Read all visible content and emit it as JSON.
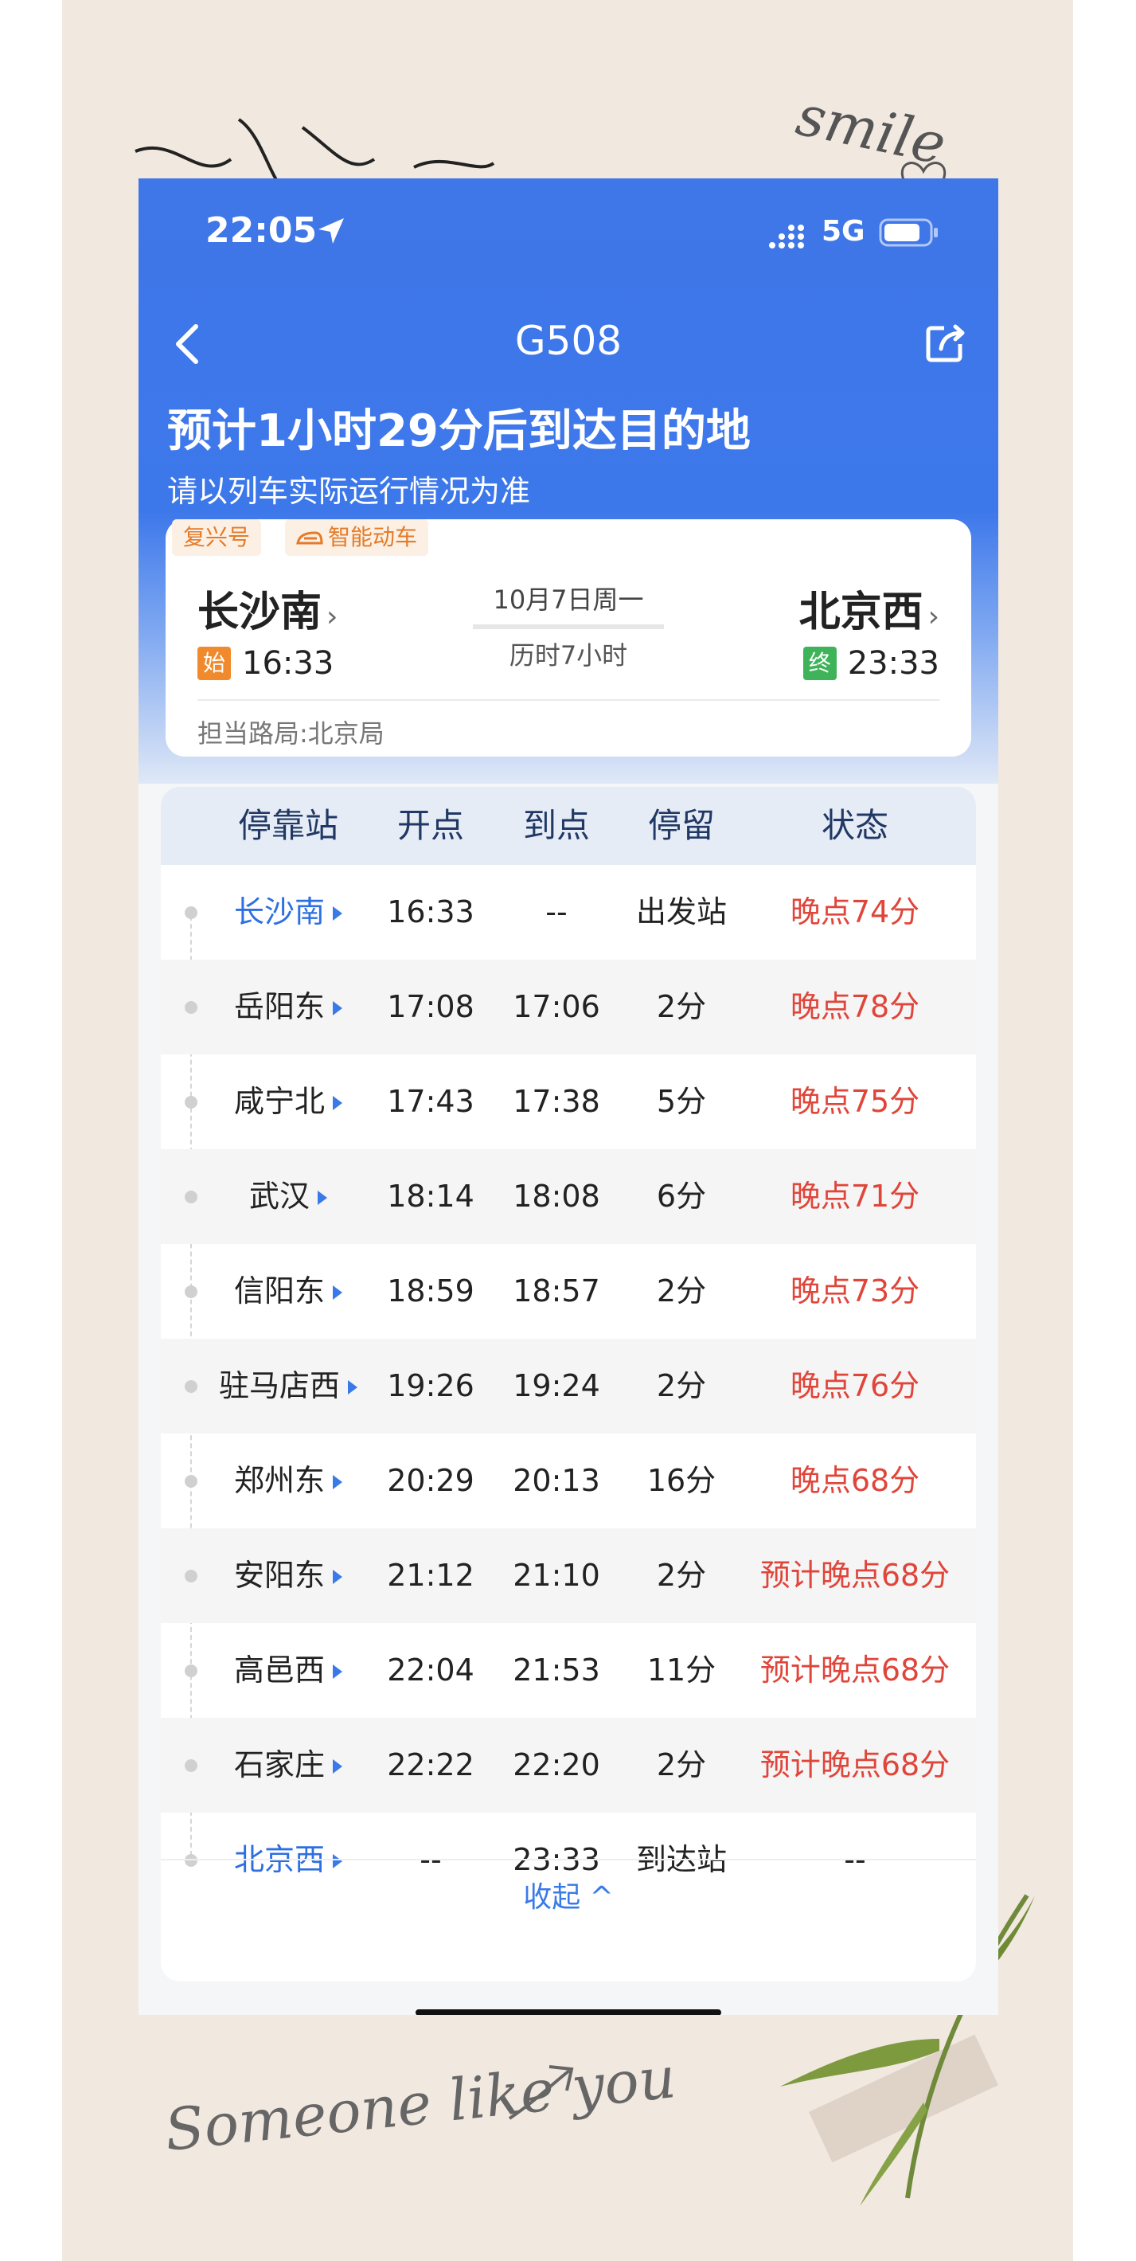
{
  "status_bar": {
    "time": "22:05",
    "network": "5G"
  },
  "nav": {
    "title": "G508"
  },
  "eta": {
    "title": "预计1小时29分后到达目的地",
    "subtitle": "请以列车实际运行情况为准"
  },
  "train_card": {
    "tags": [
      "复兴号",
      "智能动车"
    ],
    "from": {
      "name": "长沙南",
      "badge": "始",
      "time": "16:33"
    },
    "to": {
      "name": "北京西",
      "badge": "终",
      "time": "23:33"
    },
    "date": "10月7日周一",
    "duration": "历时7小时",
    "bureau": "担当路局:北京局",
    "chevron": "›"
  },
  "table": {
    "headers": [
      "停靠站",
      "开点",
      "到点",
      "停留",
      "状态"
    ],
    "rows": [
      {
        "station": "长沙南",
        "depart": "16:33",
        "arrive": "--",
        "stop": "出发站",
        "status": "晚点74分"
      },
      {
        "station": "岳阳东",
        "depart": "17:08",
        "arrive": "17:06",
        "stop": "2分",
        "status": "晚点78分"
      },
      {
        "station": "咸宁北",
        "depart": "17:43",
        "arrive": "17:38",
        "stop": "5分",
        "status": "晚点75分"
      },
      {
        "station": "武汉",
        "depart": "18:14",
        "arrive": "18:08",
        "stop": "6分",
        "status": "晚点71分"
      },
      {
        "station": "信阳东",
        "depart": "18:59",
        "arrive": "18:57",
        "stop": "2分",
        "status": "晚点73分"
      },
      {
        "station": "驻马店西",
        "depart": "19:26",
        "arrive": "19:24",
        "stop": "2分",
        "status": "晚点76分"
      },
      {
        "station": "郑州东",
        "depart": "20:29",
        "arrive": "20:13",
        "stop": "16分",
        "status": "晚点68分"
      },
      {
        "station": "安阳东",
        "depart": "21:12",
        "arrive": "21:10",
        "stop": "2分",
        "status": "预计晚点68分"
      },
      {
        "station": "高邑西",
        "depart": "22:04",
        "arrive": "21:53",
        "stop": "11分",
        "status": "预计晚点68分"
      },
      {
        "station": "石家庄",
        "depart": "22:22",
        "arrive": "22:20",
        "stop": "2分",
        "status": "预计晚点68分"
      },
      {
        "station": "北京西",
        "depart": "--",
        "arrive": "23:33",
        "stop": "到达站",
        "status": "--"
      }
    ],
    "collapse_label": "收起 ^"
  },
  "decorations": {
    "top_right": "smile",
    "bottom_left": "Someone like you"
  },
  "colors": {
    "header_blue": "#3f76e8",
    "accent_blue": "#2d6fe0",
    "late_red": "#e0453a",
    "tag_orange": "#e47b2a"
  }
}
